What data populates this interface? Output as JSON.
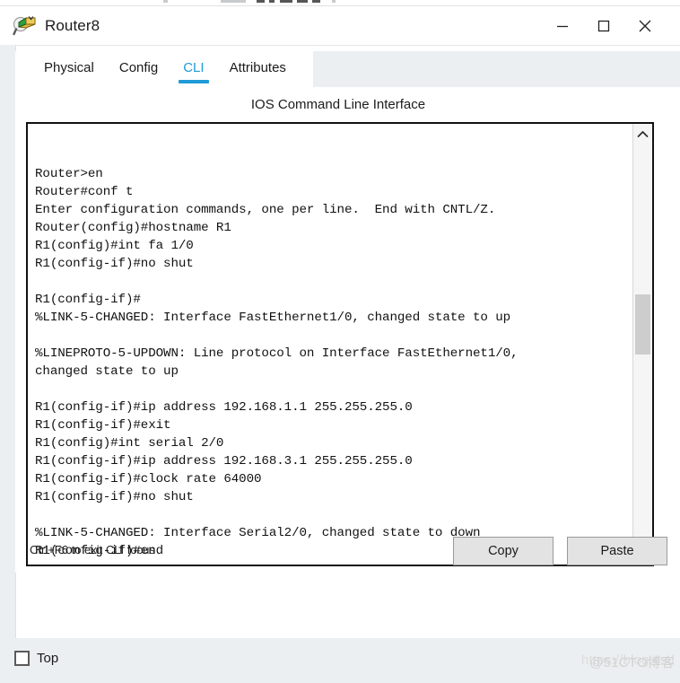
{
  "window": {
    "title": "Router8",
    "icon": "router-magnifier-icon",
    "controls": {
      "minimize": "minimize-icon",
      "maximize": "maximize-icon",
      "close": "close-icon"
    }
  },
  "tabs": [
    {
      "label": "Physical",
      "active": false
    },
    {
      "label": "Config",
      "active": false
    },
    {
      "label": "CLI",
      "active": true
    },
    {
      "label": "Attributes",
      "active": false
    }
  ],
  "panel": {
    "heading": "IOS Command Line Interface"
  },
  "terminal": {
    "lines": [
      "",
      "",
      "Router>en",
      "Router#conf t",
      "Enter configuration commands, one per line.  End with CNTL/Z.",
      "Router(config)#hostname R1",
      "R1(config)#int fa 1/0",
      "R1(config-if)#no shut",
      "",
      "R1(config-if)#",
      "%LINK-5-CHANGED: Interface FastEthernet1/0, changed state to up",
      "",
      "%LINEPROTO-5-UPDOWN: Line protocol on Interface FastEthernet1/0,",
      "changed state to up",
      "",
      "R1(config-if)#ip address 192.168.1.1 255.255.255.0",
      "R1(config-if)#exit",
      "R1(config)#int serial 2/0",
      "R1(config-if)#ip address 192.168.3.1 255.255.255.0",
      "R1(config-if)#clock rate 64000",
      "R1(config-if)#no shut",
      "",
      "%LINK-5-CHANGED: Interface Serial2/0, changed state to down",
      "R1(config-if)#end"
    ]
  },
  "scrollbar": {
    "up_icon": "chevron-up-icon",
    "down_icon": "chevron-down-icon"
  },
  "footer": {
    "hint": "Ctrl+F6 to exit CLI focus",
    "copy_label": "Copy",
    "paste_label": "Paste"
  },
  "bottom": {
    "top_checkbox_label": "Top",
    "watermark_url": "https://blog.csd",
    "watermark_tag": "@51CTO博客"
  },
  "colors": {
    "accent": "#1e9bd7",
    "panel_bg": "#ffffff",
    "chrome_bg": "#eceff1",
    "button_bg": "#e3e3e3",
    "terminal_text": "#121212"
  }
}
